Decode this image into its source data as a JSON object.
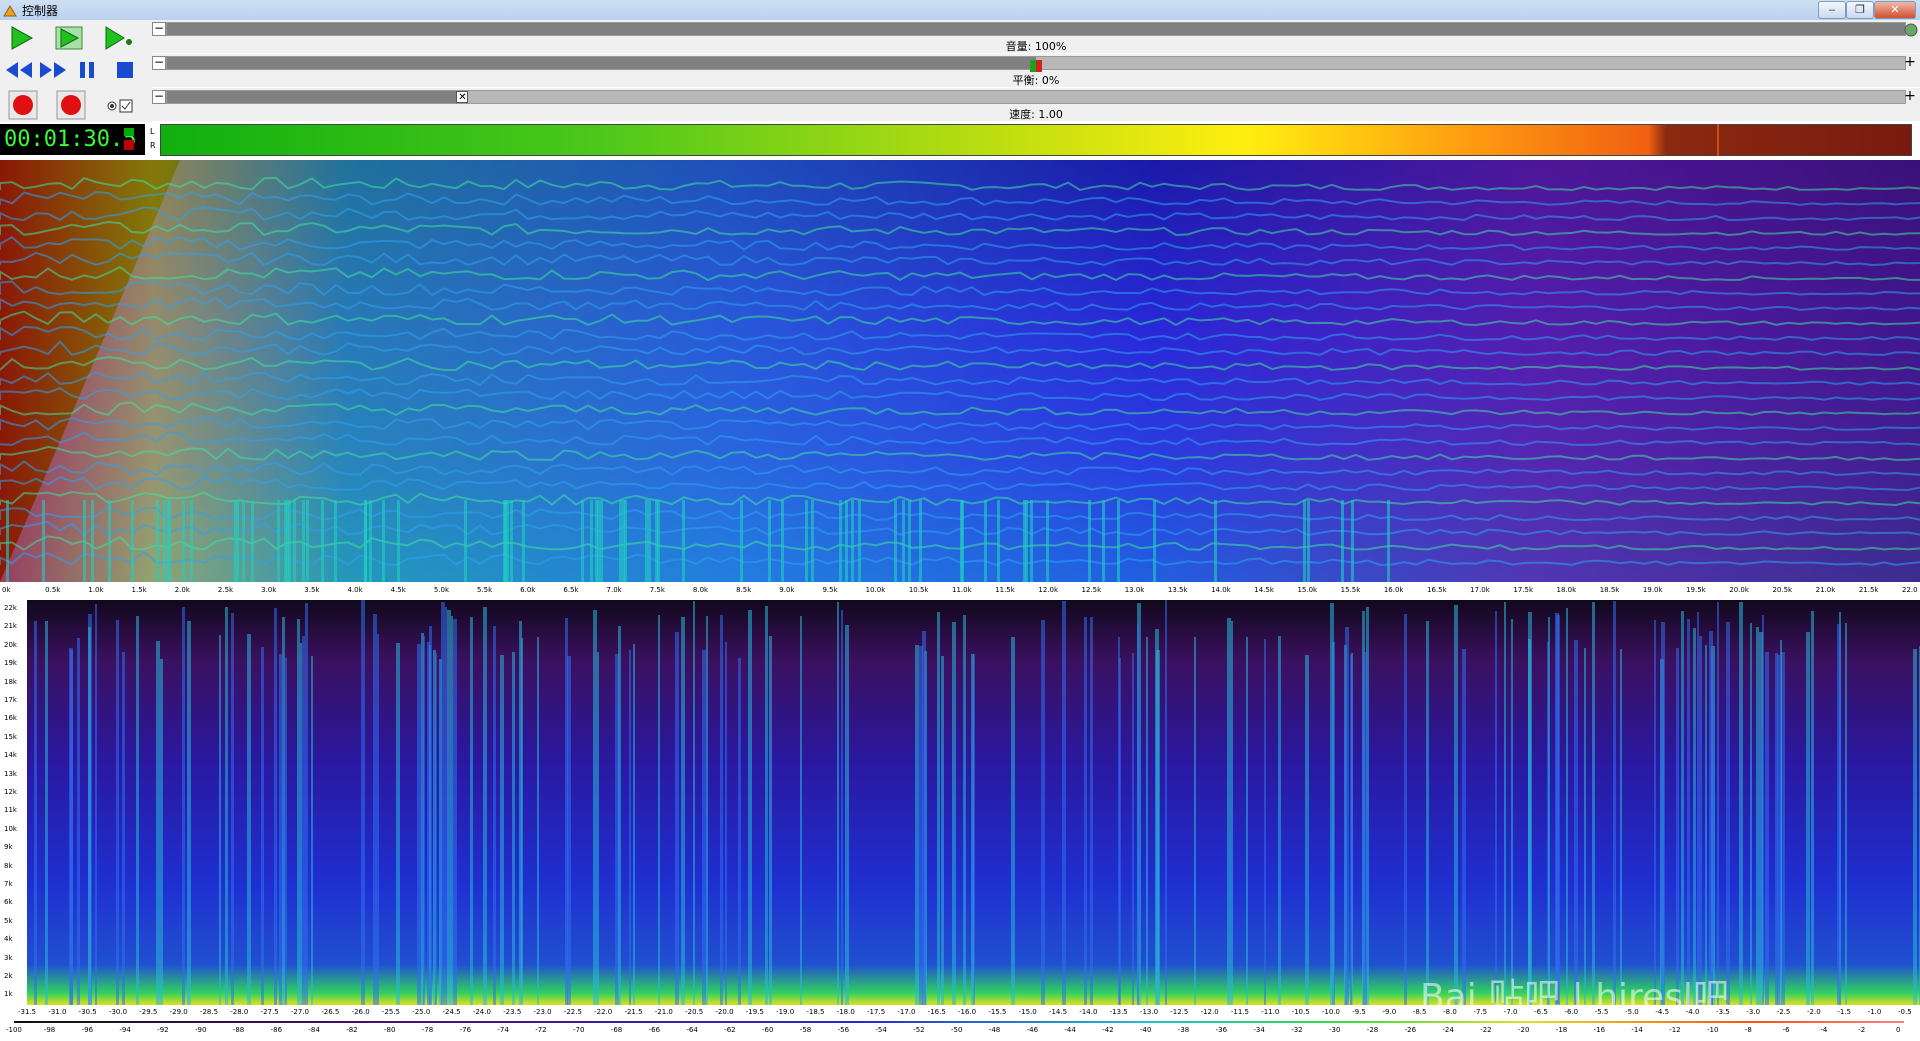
{
  "window": {
    "title": "控制器",
    "minimize": "‒",
    "restore": "❐",
    "close": "✕"
  },
  "toolbar": {
    "row1": [
      {
        "name": "play",
        "glyph": "▶"
      },
      {
        "name": "play-selection",
        "glyph": "▶"
      },
      {
        "name": "play-loop",
        "glyph": "▶"
      }
    ],
    "row2": [
      {
        "name": "rewind",
        "glyph": "◀◀"
      },
      {
        "name": "fast-forward",
        "glyph": "▶▶"
      },
      {
        "name": "pause",
        "glyph": "❚❚"
      },
      {
        "name": "stop",
        "glyph": "■"
      }
    ],
    "row3": [
      {
        "name": "record",
        "glyph": "●"
      },
      {
        "name": "record-2",
        "glyph": "●"
      },
      {
        "name": "monitor",
        "glyph": "◉"
      },
      {
        "name": "option",
        "glyph": "☑"
      }
    ]
  },
  "sliders": {
    "volume": {
      "label": "音量: 100%",
      "minus": "−",
      "plus": "+",
      "level": 1.0
    },
    "balance": {
      "label": "平衡: 0%",
      "minus": "−",
      "plus": "+",
      "level": 0.5
    },
    "speed": {
      "label": "速度: 1.00",
      "minus": "−",
      "plus": "+",
      "marker": "✕",
      "level": 0.17
    }
  },
  "time": "00:01:30.5",
  "meter": {
    "left": "L",
    "right": "R"
  },
  "freq_axis": [
    "0k",
    "0.5k",
    "1.0k",
    "1.5k",
    "2.0k",
    "2.5k",
    "3.0k",
    "3.5k",
    "4.0k",
    "4.5k",
    "5.0k",
    "5.5k",
    "6.0k",
    "6.5k",
    "7.0k",
    "7.5k",
    "8.0k",
    "8.5k",
    "9.0k",
    "9.5k",
    "10.0k",
    "10.5k",
    "11.0k",
    "11.5k",
    "12.0k",
    "12.5k",
    "13.0k",
    "13.5k",
    "14.0k",
    "14.5k",
    "15.0k",
    "15.5k",
    "16.0k",
    "16.5k",
    "17.0k",
    "17.5k",
    "18.0k",
    "18.5k",
    "19.0k",
    "19.5k",
    "20.0k",
    "20.5k",
    "21.0k",
    "21.5k",
    "22.0"
  ],
  "spectrogram_y_axis": [
    "22k",
    "21k",
    "20k",
    "19k",
    "18k",
    "17k",
    "16k",
    "15k",
    "14k",
    "13k",
    "12k",
    "11k",
    "10k",
    "9k",
    "8k",
    "7k",
    "6k",
    "5k",
    "4k",
    "3k",
    "2k",
    "1k"
  ],
  "time_axis": [
    "-31.5",
    "-31.0",
    "-30.5",
    "-30.0",
    "-29.5",
    "-29.0",
    "-28.5",
    "-28.0",
    "-27.5",
    "-27.0",
    "-26.5",
    "-26.0",
    "-25.5",
    "-25.0",
    "-24.5",
    "-24.0",
    "-23.5",
    "-23.0",
    "-22.5",
    "-22.0",
    "-21.5",
    "-21.0",
    "-20.5",
    "-20.0",
    "-19.5",
    "-19.0",
    "-18.5",
    "-18.0",
    "-17.5",
    "-17.0",
    "-16.5",
    "-16.0",
    "-15.5",
    "-15.0",
    "-14.5",
    "-14.0",
    "-13.5",
    "-13.0",
    "-12.5",
    "-12.0",
    "-11.5",
    "-11.0",
    "-10.5",
    "-10.0",
    "-9.5",
    "-9.0",
    "-8.5",
    "-8.0",
    "-7.5",
    "-7.0",
    "-6.5",
    "-6.0",
    "-5.5",
    "-5.0",
    "-4.5",
    "-4.0",
    "-3.5",
    "-3.0",
    "-2.5",
    "-2.0",
    "-1.5",
    "-1.0",
    "-0.5"
  ],
  "db_axis": [
    "-100",
    "-98",
    "-96",
    "-94",
    "-92",
    "-90",
    "-88",
    "-86",
    "-84",
    "-82",
    "-80",
    "-78",
    "-76",
    "-74",
    "-72",
    "-70",
    "-68",
    "-66",
    "-64",
    "-62",
    "-60",
    "-58",
    "-56",
    "-54",
    "-52",
    "-50",
    "-48",
    "-46",
    "-44",
    "-42",
    "-40",
    "-38",
    "-36",
    "-34",
    "-32",
    "-30",
    "-28",
    "-26",
    "-24",
    "-22",
    "-20",
    "-18",
    "-16",
    "-14",
    "-12",
    "-10",
    "-8",
    "-6",
    "-4",
    "-2",
    "0"
  ],
  "watermark": "Bai 贴吧 | hiresl吧"
}
